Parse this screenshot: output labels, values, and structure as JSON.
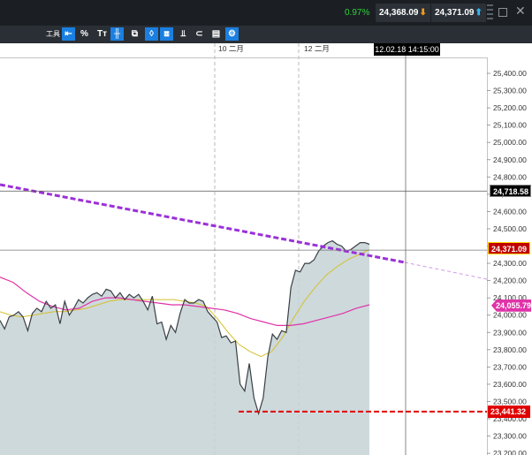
{
  "header": {
    "change_pct": "0.97%",
    "bid": "24,368.09",
    "ask": "24,371.09",
    "bid_arrow_icon": "down-arrow",
    "ask_arrow_icon": "up-arrow",
    "colors": {
      "change": "#2fd13a",
      "bid_arrow": "#f39a1e",
      "ask_arrow": "#36b6f2"
    }
  },
  "toolbar": {
    "label": "工具",
    "tools": [
      {
        "name": "back-icon",
        "glyph": "⇤",
        "active": true
      },
      {
        "name": "percent-icon",
        "glyph": "%",
        "active": false
      },
      {
        "name": "text-icon",
        "glyph": "Tт",
        "active": false
      },
      {
        "name": "crosshair-icon",
        "glyph": "╫",
        "active": true
      },
      {
        "name": "candles-icon",
        "glyph": "⧉",
        "active": false
      },
      {
        "name": "indicator-icon",
        "glyph": "◊",
        "active": true
      },
      {
        "name": "windows-icon",
        "glyph": "⧈",
        "active": true
      },
      {
        "name": "drawing-icon",
        "glyph": "⫫",
        "active": false
      },
      {
        "name": "label-icon",
        "glyph": "⊂",
        "active": false
      },
      {
        "name": "print-icon",
        "glyph": "▤",
        "active": false
      },
      {
        "name": "settings-icon",
        "glyph": "⚙",
        "active": true
      }
    ]
  },
  "chart_data": {
    "type": "line",
    "x_labels": [
      "10 二月",
      "12 二月"
    ],
    "crosshair_time": "12.02.18 14:15:00",
    "ylim": [
      23200,
      25450
    ],
    "y_ticks": [
      "25,400.00",
      "25,300.00",
      "25,200.00",
      "25,100.00",
      "25,000.00",
      "24,900.00",
      "24,800.00",
      "24,700.00",
      "24,600.00",
      "24,500.00",
      "24,400.00",
      "24,300.00",
      "24,200.00",
      "24,100.00",
      "24,000.00",
      "23,900.00",
      "23,800.00",
      "23,700.00",
      "23,600.00",
      "23,500.00",
      "23,400.00",
      "23,300.00",
      "23,200.00"
    ],
    "crosshair_value": "24,718.58",
    "last_price": "24,371.09",
    "ma_slow_value": "24,055.79",
    "support_value": "23,441.32",
    "colors": {
      "price": "#3a3f44",
      "ma_fast": "#d4c02a",
      "ma_slow": "#e033a8",
      "trendline": "#9b30d9",
      "support": "#e00000"
    },
    "series": [
      {
        "values": [
          23970,
          23920,
          23990,
          24000,
          24020,
          23990,
          23910,
          24010,
          24040,
          24020,
          24080,
          24040,
          24060,
          23950,
          24080,
          24000,
          24040,
          24090,
          24070,
          24100,
          24120,
          24130,
          24110,
          24150,
          24140,
          24100,
          24130,
          24090,
          24120,
          24100,
          24120,
          24080,
          24030,
          24110,
          23950,
          23960,
          23860,
          23940,
          23900,
          24010,
          24090,
          24070,
          24070,
          24090,
          24080,
          24020,
          23990,
          23960,
          23870,
          23880,
          23840,
          23850,
          23600,
          23560,
          23720,
          23520,
          23430,
          23520,
          23760,
          23890,
          23860,
          23910,
          23900,
          24160,
          24260,
          24250,
          24300,
          24300,
          24320,
          24370,
          24400,
          24420,
          24430,
          24410,
          24400,
          24370,
          24380,
          24400,
          24420,
          24420,
          24410
        ]
      },
      {
        "values": [
          24020,
          24000,
          23990,
          24000,
          24010,
          24020,
          24020,
          24030,
          24040,
          24060,
          24080,
          24090,
          24090,
          24090,
          24090,
          24090,
          24090,
          24080,
          24070,
          24050,
          23980,
          23900,
          23830,
          23790,
          23760,
          23790,
          23870,
          23980,
          24080,
          24160,
          24230,
          24280,
          24320,
          24350,
          24380
        ]
      },
      {
        "values": [
          24220,
          24190,
          24130,
          24080,
          24050,
          24030,
          24040,
          24080,
          24100,
          24100,
          24090,
          24080,
          24070,
          24060,
          24060,
          24050,
          24040,
          24030,
          24010,
          23980,
          23960,
          23940,
          23940,
          23950,
          23970,
          23990,
          24010,
          24040,
          24060
        ]
      }
    ]
  }
}
